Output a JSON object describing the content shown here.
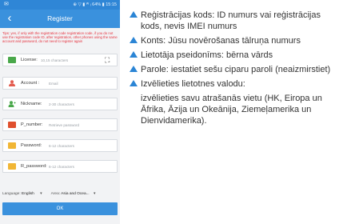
{
  "status_bar": {
    "left_icon": "notification-icon",
    "right": "⊕ ▽ ▮ ᵂ ᵢ 64% ▮ 15:15"
  },
  "app": {
    "title": "Register",
    "back_icon": "back-arrow-icon"
  },
  "tips": "Tips: yes, if only with the registration code registration code, if you do not use the registration code ID, after registration, other phones using the same account and password, do not need to register again",
  "form": {
    "license": {
      "label": "License:",
      "placeholder": "10,15 characters",
      "scan_icon": "scan-icon"
    },
    "account": {
      "label": "Account :",
      "placeholder": "Email"
    },
    "nickname": {
      "label": "Nickname:",
      "placeholder": "2-30 characters"
    },
    "p_number": {
      "label": "P_number:",
      "placeholder": "Retrieve password"
    },
    "password": {
      "label": "Password:",
      "placeholder": "6-12 characters"
    },
    "r_password": {
      "label": "R_password:",
      "placeholder": "6-12 characters"
    },
    "language": {
      "label": "Language:",
      "value": "English"
    },
    "area": {
      "label": "Area:",
      "value": "Asia and Ocea..."
    },
    "ok_label": "OK"
  },
  "info": {
    "b1": "Reģistrācijas kods: ID numurs vai reģistrācijas kods, nevis IMEI numurs",
    "b2": "Konts: Jūsu novērošanas tālruņa numurs",
    "b3": "Lietotāja pseidonīms: bērna vārds",
    "b4": "Parole: iestatiet sešu ciparu paroli (neaizmirstiet)",
    "b5": "Izvēlieties lietotnes valodu:",
    "b6": "izvēlieties savu atrašanās vietu (HK, Eiropa un Āfrika, Āzija un Okeānija, Ziemeļamerika un Dienvidamerika)."
  },
  "colors": {
    "app_blue": "#3a91dd",
    "status_blue": "#2f86d6",
    "tips_red": "#e5323e",
    "bullet_blue": "#2b85d5",
    "license_green": "#4aa84b",
    "pnumber_red": "#e0502e",
    "lock_yellow": "#f1b635"
  }
}
